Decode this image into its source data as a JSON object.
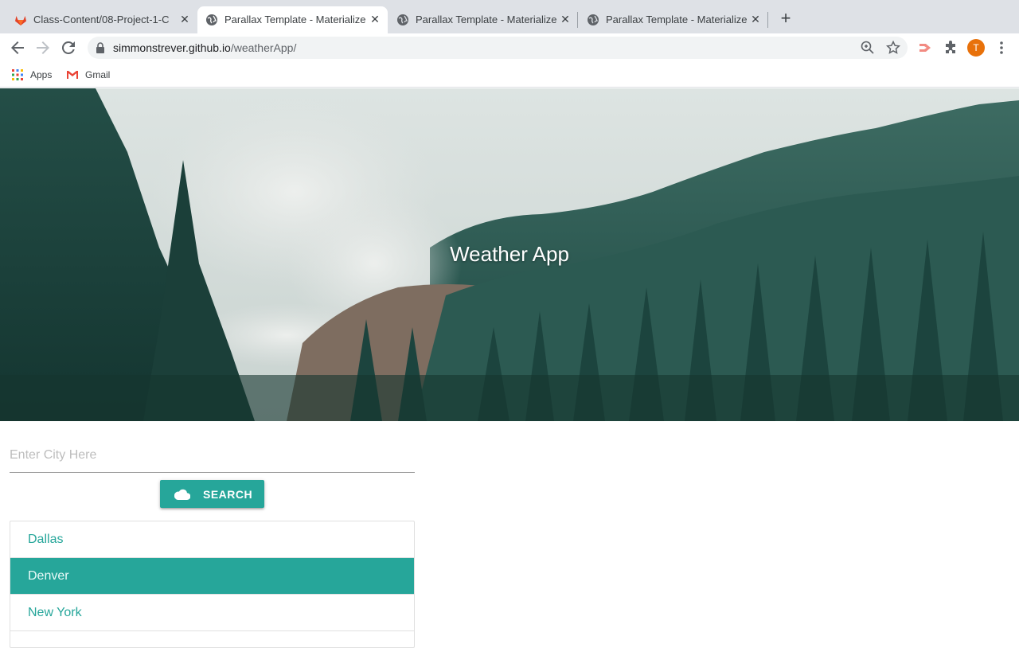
{
  "browser": {
    "tabs": [
      {
        "title": "Class-Content/08-Project-1-C",
        "favicon": "gitlab-icon",
        "active": false
      },
      {
        "title": "Parallax Template - Materialize",
        "favicon": "globe-icon",
        "active": true
      },
      {
        "title": "Parallax Template - Materialize",
        "favicon": "globe-icon",
        "active": false
      },
      {
        "title": "Parallax Template - Materialize",
        "favicon": "globe-icon",
        "active": false
      }
    ],
    "url_host": "simmonstrever.github.io",
    "url_path": "/weatherApp/",
    "profile_initial": "T",
    "bookmarks": [
      {
        "label": "Apps",
        "icon": "apps-grid-icon"
      },
      {
        "label": "Gmail",
        "icon": "gmail-icon"
      }
    ]
  },
  "hero": {
    "title": "Weather App"
  },
  "search": {
    "placeholder": "Enter City Here",
    "button_label": "SEARCH",
    "button_icon": "cloud-icon"
  },
  "cities": [
    {
      "name": "Dallas",
      "active": false
    },
    {
      "name": "Denver",
      "active": true
    },
    {
      "name": "New York",
      "active": false
    }
  ],
  "colors": {
    "accent": "#26a69a",
    "tab_bar": "#dee1e6"
  }
}
